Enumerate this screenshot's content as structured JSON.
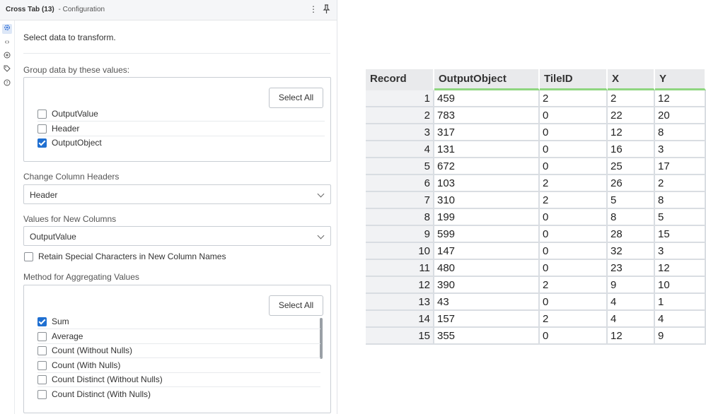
{
  "panel": {
    "title": "Cross Tab (13)",
    "subtitle": "- Configuration",
    "more_icon": "more-vertical-icon",
    "pin_icon": "pin-icon"
  },
  "rail": {
    "icons": [
      "gear-icon",
      "code-icon",
      "annotation-icon",
      "tag-icon",
      "help-icon"
    ]
  },
  "intro": "Select data to transform.",
  "group": {
    "label": "Group data by these values:",
    "select_all": "Select All",
    "items": [
      {
        "label": "OutputValue",
        "checked": false
      },
      {
        "label": "Header",
        "checked": false
      },
      {
        "label": "OutputObject",
        "checked": true
      }
    ]
  },
  "column_headers": {
    "label": "Change Column Headers",
    "value": "Header"
  },
  "new_values": {
    "label": "Values for New Columns",
    "value": "OutputValue"
  },
  "retain": {
    "label": "Retain Special Characters in New Column Names",
    "checked": false
  },
  "aggregation": {
    "label": "Method for Aggregating Values",
    "select_all": "Select All",
    "items": [
      {
        "label": "Sum",
        "checked": true
      },
      {
        "label": "Average",
        "checked": false
      },
      {
        "label": "Count (Without Nulls)",
        "checked": false
      },
      {
        "label": "Count (With Nulls)",
        "checked": false
      },
      {
        "label": "Count Distinct (Without Nulls)",
        "checked": false
      },
      {
        "label": "Count Distinct (With Nulls)",
        "checked": false
      }
    ]
  },
  "grid": {
    "columns": [
      "Record",
      "OutputObject",
      "TileID",
      "X",
      "Y"
    ],
    "rows": [
      [
        "1",
        "459",
        "2",
        "2",
        "12"
      ],
      [
        "2",
        "783",
        "0",
        "22",
        "20"
      ],
      [
        "3",
        "317",
        "0",
        "12",
        "8"
      ],
      [
        "4",
        "131",
        "0",
        "16",
        "3"
      ],
      [
        "5",
        "672",
        "0",
        "25",
        "17"
      ],
      [
        "6",
        "103",
        "2",
        "26",
        "2"
      ],
      [
        "7",
        "310",
        "2",
        "5",
        "8"
      ],
      [
        "8",
        "199",
        "0",
        "8",
        "5"
      ],
      [
        "9",
        "599",
        "0",
        "28",
        "15"
      ],
      [
        "10",
        "147",
        "0",
        "32",
        "3"
      ],
      [
        "11",
        "480",
        "0",
        "23",
        "12"
      ],
      [
        "12",
        "390",
        "2",
        "9",
        "10"
      ],
      [
        "13",
        "43",
        "0",
        "4",
        "1"
      ],
      [
        "14",
        "157",
        "2",
        "4",
        "4"
      ],
      [
        "15",
        "355",
        "0",
        "12",
        "9"
      ]
    ]
  }
}
